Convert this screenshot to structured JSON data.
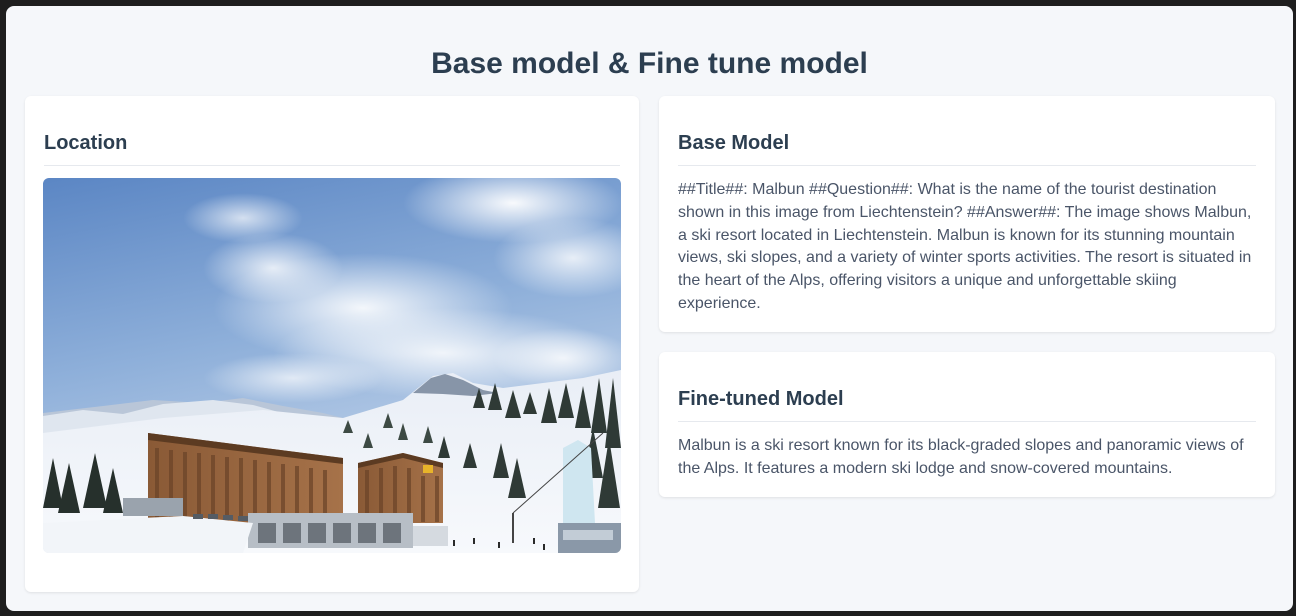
{
  "page": {
    "title": "Base model & Fine tune model"
  },
  "location_card": {
    "heading": "Location",
    "image_description_icon": "photo-malbun-ski-resort"
  },
  "base_model_card": {
    "heading": "Base Model",
    "text": "##Title##: Malbun ##Question##: What is the name of the tourist destination shown in this image from Liechtenstein? ##Answer##: The image shows Malbun, a ski resort located in Liechtenstein. Malbun is known for its stunning mountain views, ski slopes, and a variety of winter sports activities. The resort is situated in the heart of the Alps, offering visitors a unique and unforgettable skiing experience."
  },
  "fine_tuned_card": {
    "heading": "Fine-tuned Model",
    "text": "Malbun is a ski resort known for its black-graded slopes and panoramic views of the Alps. It features a modern ski lodge and snow-covered mountains."
  },
  "colors": {
    "background": "#f5f7fa",
    "card": "#ffffff",
    "heading": "#2c3e50",
    "body_text": "#4a5568"
  }
}
